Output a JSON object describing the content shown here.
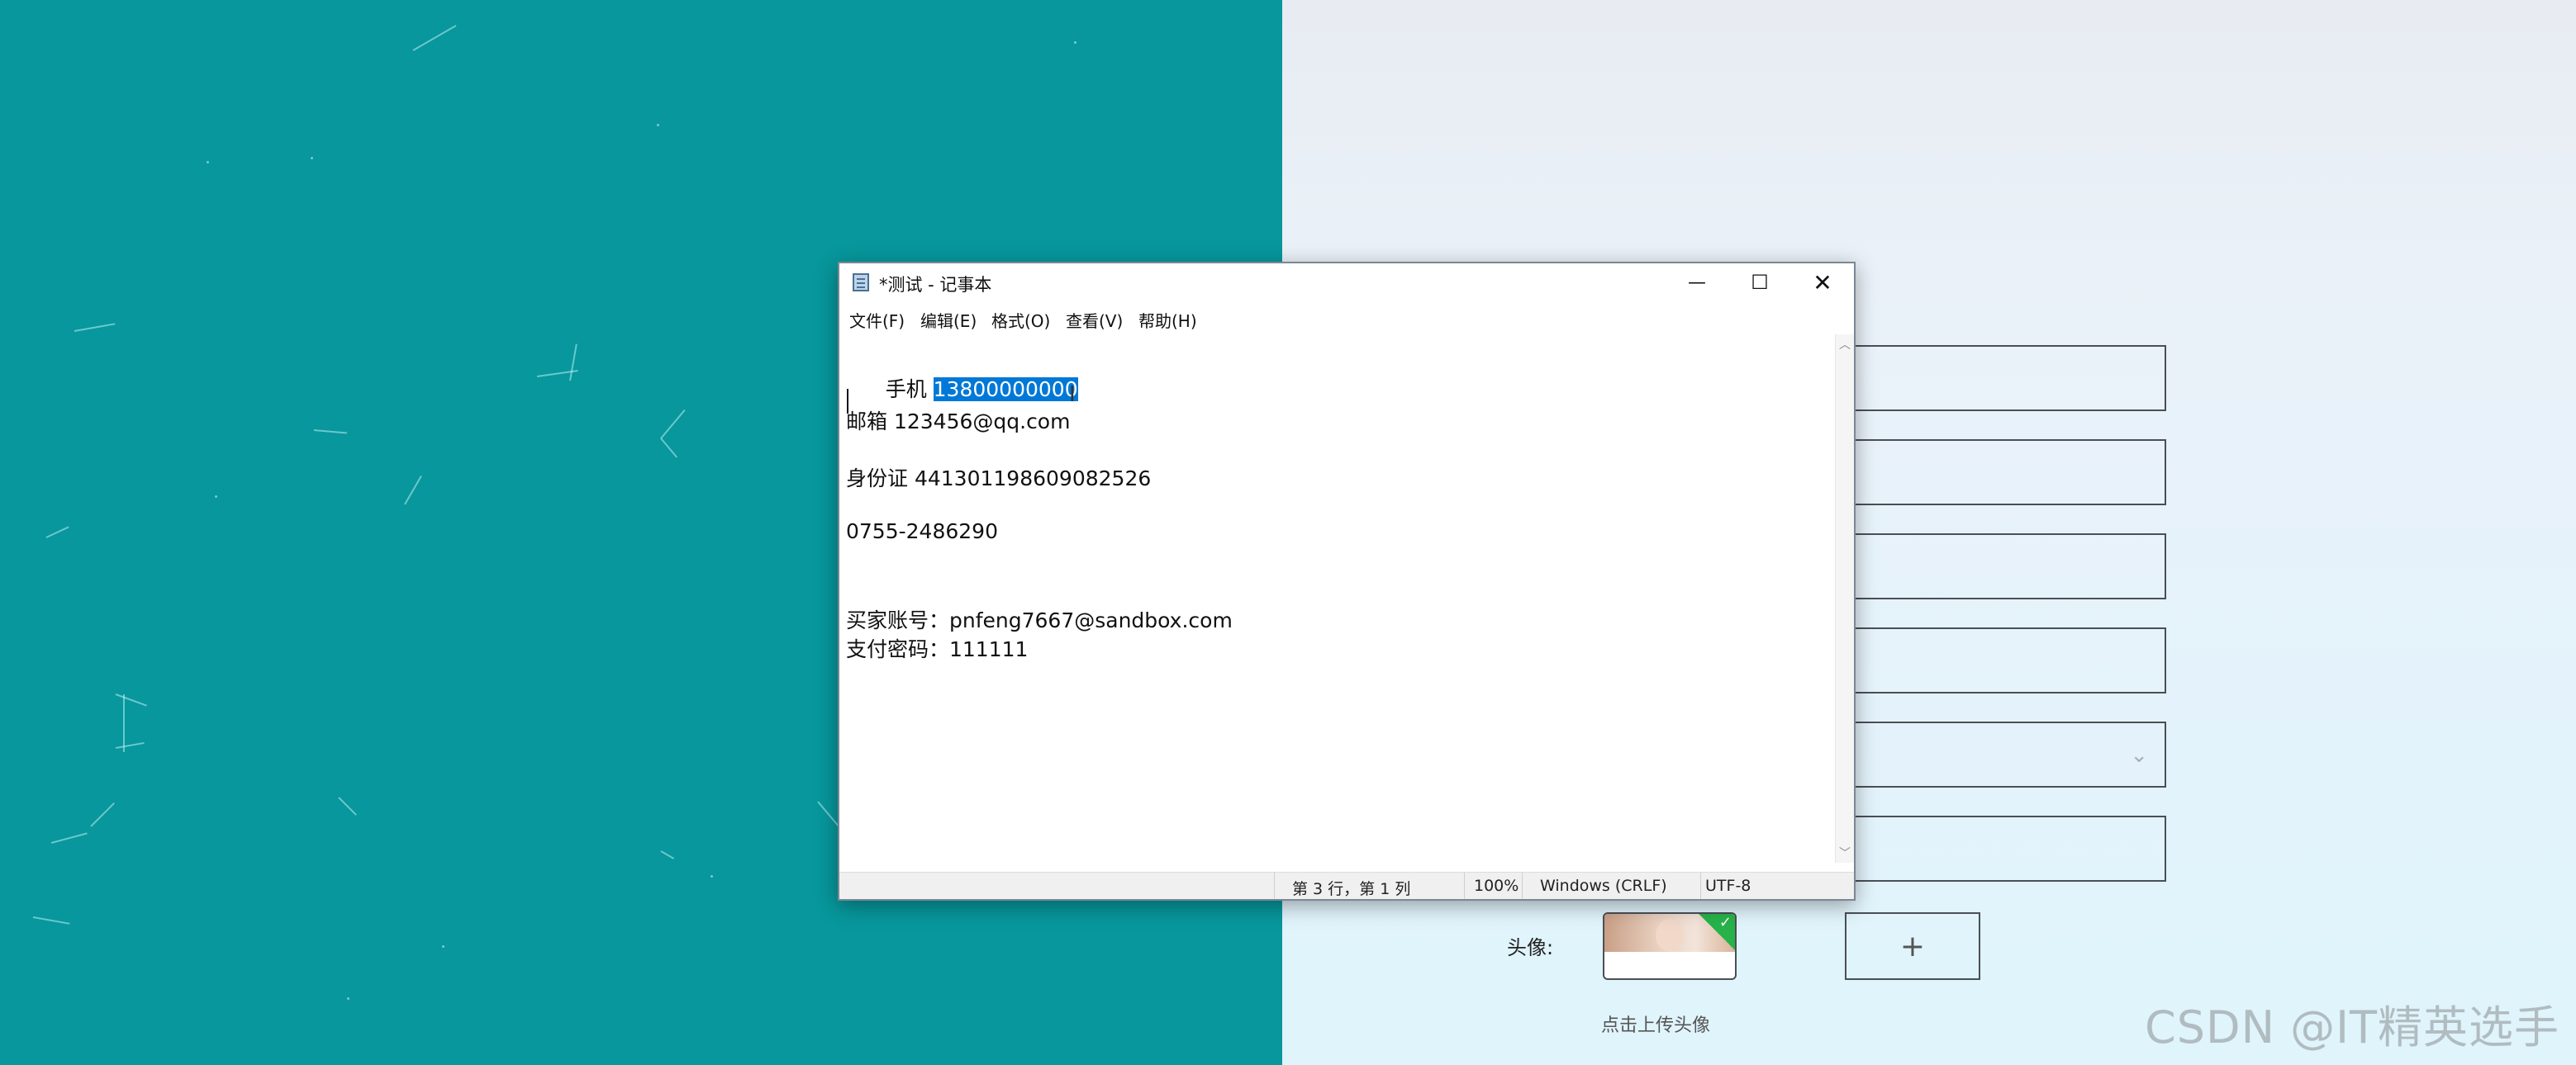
{
  "notepad": {
    "title": "*测试 - 记事本",
    "controls": {
      "minimize": "—",
      "maximize": "☐",
      "close": "✕"
    },
    "menu": [
      "文件(F)",
      "编辑(E)",
      "格式(O)",
      "查看(V)",
      "帮助(H)"
    ],
    "content": {
      "phone_label": "手机 ",
      "phone_value": "13800000000",
      "email": "邮箱 123456@qq.com",
      "id_card": "身份证 441301198609082526",
      "landline": "0755-2486290",
      "buyer_account": "买家账号：pnfeng7667@sandbox.com",
      "pay_password": "支付密码：111111"
    },
    "status": {
      "position": "第 3 行，第 1 列",
      "zoom": "100%",
      "line_ending": "Windows (CRLF)",
      "encoding": "UTF-8"
    }
  },
  "form": {
    "avatar_label": "头像:",
    "upload_plus": "+",
    "upload_hint": "点击上传头像",
    "select_chevron": "⌄"
  },
  "watermark": "CSDN @IT精英选手",
  "colors": {
    "left_bg": "#07979c",
    "selection": "#0078d7"
  }
}
